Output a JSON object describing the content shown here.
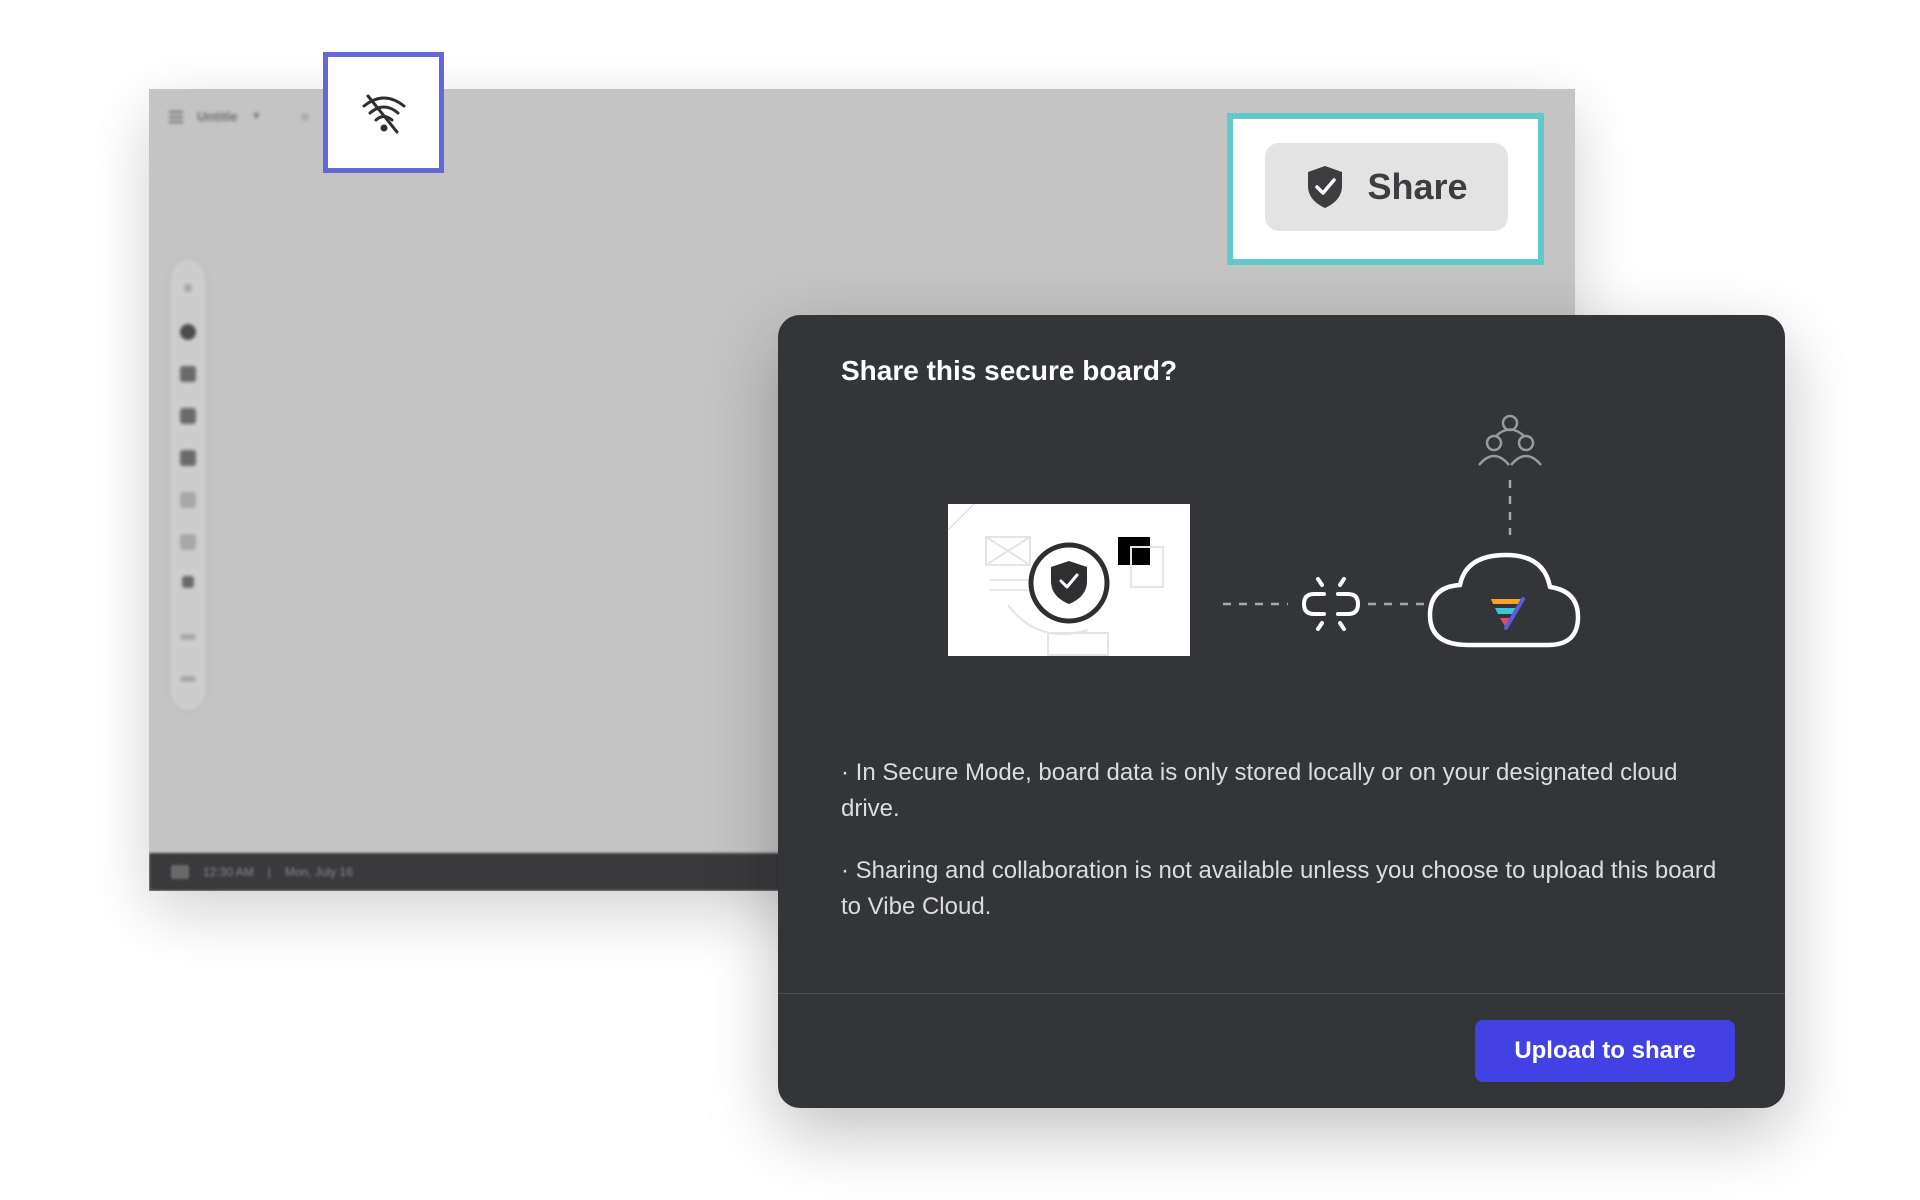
{
  "background_app": {
    "title": "Untitle",
    "status_time": "12:30 AM",
    "status_date": "Mon, July 16"
  },
  "highlights": {
    "offline_icon": "no-wifi-icon",
    "share_button": {
      "label": "Share",
      "icon": "shield-check-icon"
    }
  },
  "dialog": {
    "title": "Share this secure board?",
    "bullets": [
      "· In Secure Mode, board data is only stored locally or on your designated cloud drive.",
      "· Sharing and collaboration is not available unless you choose to upload this board to Vibe Cloud."
    ],
    "primary_button": "Upload to share"
  },
  "colors": {
    "dialog_bg": "#343538",
    "primary": "#4242e4",
    "highlight_purple": "#6467d6",
    "highlight_teal": "#5fcac7"
  }
}
